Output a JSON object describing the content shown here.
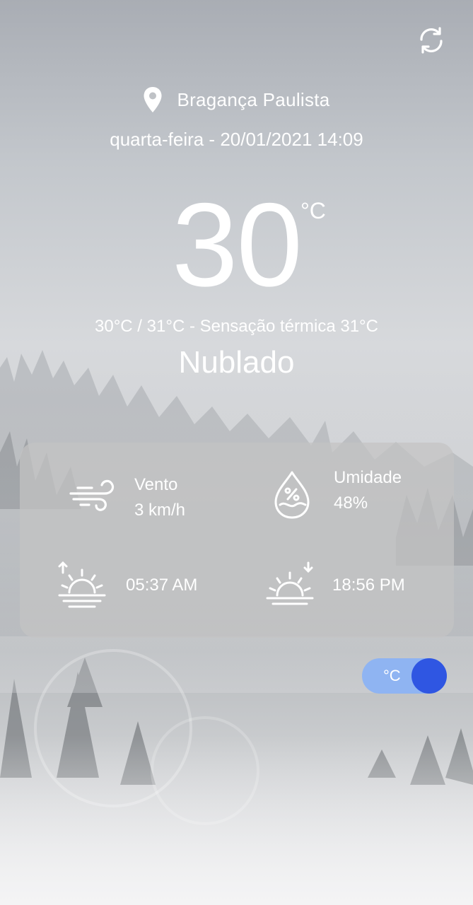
{
  "location": {
    "city": "Bragança Paulista"
  },
  "datetime": "quarta-feira - 20/01/2021 14:09",
  "current": {
    "temperature": "30",
    "unit": "°C",
    "minmax_feels": "30°C / 31°C - Sensação térmica 31°C",
    "condition": "Nublado"
  },
  "details": {
    "wind": {
      "label": "Vento",
      "value": "3 km/h"
    },
    "humidity": {
      "label": "Umidade",
      "value": "48%"
    },
    "sunrise": {
      "value": "05:37 AM"
    },
    "sunset": {
      "value": "18:56 PM"
    }
  },
  "unit_toggle": {
    "label": "°C",
    "checked": true
  },
  "icons": [
    "refresh-icon",
    "location-pin-icon",
    "wind-icon",
    "humidity-drop-icon",
    "sunrise-icon",
    "sunset-icon"
  ],
  "colors": {
    "toggle_track": "#8fb4f2",
    "toggle_knob": "#2f56e2",
    "card": "#c4c4c4"
  }
}
